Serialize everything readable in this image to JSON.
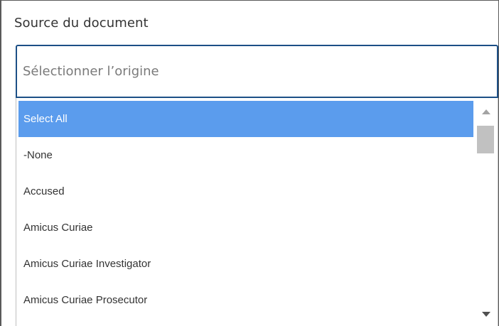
{
  "field": {
    "label": "Source du document",
    "placeholder": "Sélectionner l’origine"
  },
  "dropdown": {
    "options": [
      {
        "label": "Select All",
        "selected": true
      },
      {
        "label": "-None",
        "selected": false
      },
      {
        "label": "Accused",
        "selected": false
      },
      {
        "label": "Amicus Curiae",
        "selected": false
      },
      {
        "label": "Amicus Curiae Investigator",
        "selected": false
      },
      {
        "label": "Amicus Curiae Prosecutor",
        "selected": false
      }
    ]
  },
  "icons": {
    "scroll_up": "triangle-up-icon",
    "scroll_down": "triangle-down-icon"
  },
  "colors": {
    "selected_bg": "#5b9ced",
    "input_border": "#1c4f86",
    "placeholder": "#7a7a7a"
  }
}
